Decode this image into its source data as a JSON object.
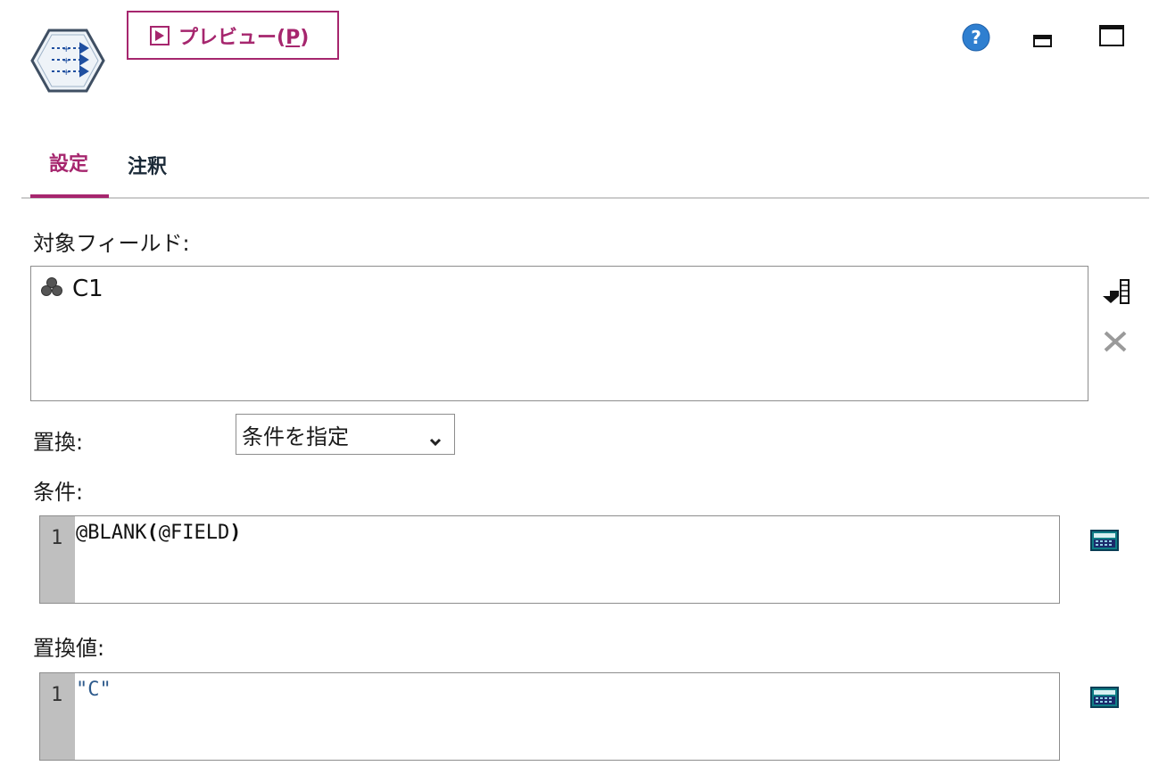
{
  "header": {
    "node_icon": "filler-node-icon",
    "preview_label": "プレビュー(",
    "preview_mnemonic": "P",
    "preview_close": ")",
    "help_icon": "help-icon",
    "minimize_icon": "minimize-icon",
    "maximize_icon": "maximize-icon"
  },
  "tabs": [
    {
      "label": "設定",
      "active": true
    },
    {
      "label": "注釈",
      "active": false
    }
  ],
  "fields": {
    "label": "対象フィールド:",
    "items": [
      {
        "name": "C1",
        "icon": "nominal-field-icon"
      }
    ],
    "picker_icon": "field-picker-icon",
    "remove_icon": "remove-field-icon"
  },
  "replace": {
    "label": "置換:",
    "selected": "条件を指定"
  },
  "condition": {
    "label": "条件:",
    "line_number": "1",
    "code_prefix": "@BLANK",
    "code_open": "(",
    "code_arg": "@FIELD",
    "code_close": ")",
    "calc_icon": "expression-builder-icon"
  },
  "replacement": {
    "label": "置換値:",
    "line_number": "1",
    "code": "\"C\"",
    "calc_icon": "expression-builder-icon"
  },
  "colors": {
    "accent": "#a6266e",
    "help_blue": "#2f7fd0",
    "gutter": "#bfbfbf",
    "string_literal": "#2d5a8c"
  }
}
